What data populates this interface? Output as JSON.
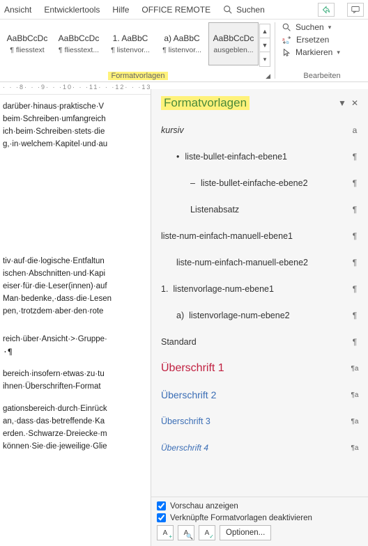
{
  "menu": {
    "items": [
      "Ansicht",
      "Entwicklertools",
      "Hilfe",
      "OFFICE REMOTE"
    ],
    "search_placeholder": "Suchen"
  },
  "ribbon": {
    "gallery": [
      {
        "sample": "AaBbCcDc",
        "label": "¶ fliesstext"
      },
      {
        "sample": "AaBbCcDc",
        "label": "¶ fliesstext..."
      },
      {
        "sample": "1.  AaBbC",
        "label": "¶ listenvor..."
      },
      {
        "sample": "a)  AaBbC",
        "label": "¶ listenvor..."
      },
      {
        "sample": "AaBbCcDc",
        "label": "ausgeblen...",
        "selected": true
      }
    ],
    "group_styles": "Formatvorlagen",
    "group_edit": "Bearbeiten",
    "edit": {
      "find": "Suchen",
      "replace": "Ersetzen",
      "select": "Markieren"
    }
  },
  "ruler": "· · ·8· · ·9· · ·10· · ·11· · ·12· · ·13· ·",
  "doc": {
    "block1": [
      "darüber·hinaus·praktische·V",
      "beim·Schreiben·umfangreich",
      "ich·beim·Schreiben·stets·die",
      "g,·in·welchem·Kapitel·und·au"
    ],
    "block2": [
      "tiv·auf·die·logische·Entfaltun",
      "ischen·Abschnitten·und·Kapi",
      "eiser·für·die·Leser(innen)·auf",
      "Man·bedenke,·dass·die·Lesen",
      "pen,·trotzdem·aber·den·rote"
    ],
    "block3": [
      "reich·über·Ansicht·>·Gruppe·",
      "·¶"
    ],
    "block4": [
      "bereich·insofern·etwas·zu·tu",
      "ihnen·Überschriften-Format"
    ],
    "block5": [
      "gationsbereich·durch·Einrück",
      "an,·dass·das·betreffende·Ka",
      "erden.·Schwarze·Dreiecke·m",
      "können·Sie·die·jeweilige·Glie"
    ]
  },
  "pane": {
    "title": "Formatvorlagen",
    "styles": [
      {
        "name": "kursiv",
        "marker": "a",
        "italic": true
      },
      {
        "name": "liste-bullet-einfach-ebene1",
        "marker": "¶",
        "indent": 1,
        "bullet": true
      },
      {
        "name": "liste-bullet-einfache-ebene2",
        "marker": "¶",
        "indent": 2,
        "dash": true
      },
      {
        "name": "Listenabsatz",
        "marker": "¶",
        "indent": 2
      },
      {
        "name": "liste-num-einfach-manuell-ebene1",
        "marker": "¶"
      },
      {
        "name": "liste-num-einfach-manuell-ebene2",
        "marker": "¶",
        "indent": 1
      },
      {
        "name": "listenvorlage-num-ebene1",
        "marker": "¶",
        "prefix": "1."
      },
      {
        "name": "listenvorlage-num-ebene2",
        "marker": "¶",
        "indent": 1,
        "prefix": "a)"
      },
      {
        "name": "Standard",
        "marker": "¶"
      },
      {
        "name": "Überschrift 1",
        "marker": "¶a",
        "cls": "h1"
      },
      {
        "name": "Überschrift 2",
        "marker": "¶a",
        "cls": "h2"
      },
      {
        "name": "Überschrift 3",
        "marker": "¶a",
        "cls": "h3"
      },
      {
        "name": "Überschrift 4",
        "marker": "¶a",
        "cls": "h4"
      }
    ],
    "footer": {
      "preview": "Vorschau anzeigen",
      "disable_linked": "Verknüpfte Formatvorlagen deaktivieren",
      "options": "Optionen..."
    }
  }
}
